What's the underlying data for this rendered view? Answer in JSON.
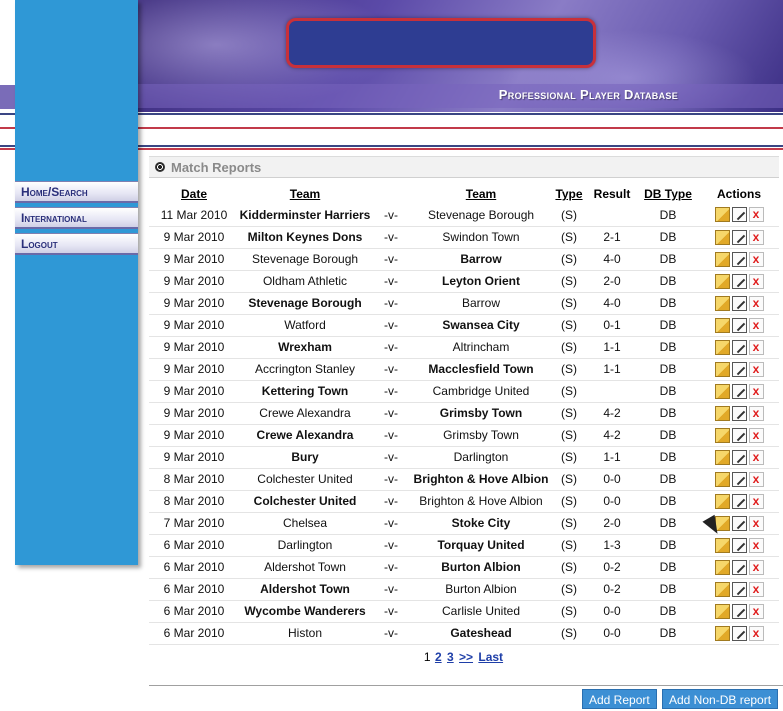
{
  "header": {
    "title": "Professional Player Database"
  },
  "nav": [
    {
      "label": "Home/Search"
    },
    {
      "label": "International"
    },
    {
      "label": "Logout"
    }
  ],
  "section": {
    "title": "Match Reports"
  },
  "table": {
    "headers": {
      "date": "Date",
      "team1": "Team",
      "team2": "Team",
      "type": "Type",
      "result": "Result",
      "dbtype": "DB Type",
      "actions": "Actions"
    },
    "rows": [
      {
        "date": "11 Mar 2010",
        "team1": "Kidderminster Harriers",
        "vs": "-v-",
        "team2": "Stevenage Borough",
        "type": "(S)",
        "result": "",
        "dbtype": "DB",
        "bold": "team1"
      },
      {
        "date": "9 Mar 2010",
        "team1": "Milton Keynes Dons",
        "vs": "-v-",
        "team2": "Swindon Town",
        "type": "(S)",
        "result": "2-1",
        "dbtype": "DB",
        "bold": "team1"
      },
      {
        "date": "9 Mar 2010",
        "team1": "Stevenage Borough",
        "vs": "-v-",
        "team2": "Barrow",
        "type": "(S)",
        "result": "4-0",
        "dbtype": "DB",
        "bold": "team2"
      },
      {
        "date": "9 Mar 2010",
        "team1": "Oldham Athletic",
        "vs": "-v-",
        "team2": "Leyton Orient",
        "type": "(S)",
        "result": "2-0",
        "dbtype": "DB",
        "bold": "team2"
      },
      {
        "date": "9 Mar 2010",
        "team1": "Stevenage Borough",
        "vs": "-v-",
        "team2": "Barrow",
        "type": "(S)",
        "result": "4-0",
        "dbtype": "DB",
        "bold": "team1"
      },
      {
        "date": "9 Mar 2010",
        "team1": "Watford",
        "vs": "-v-",
        "team2": "Swansea City",
        "type": "(S)",
        "result": "0-1",
        "dbtype": "DB",
        "bold": "team2"
      },
      {
        "date": "9 Mar 2010",
        "team1": "Wrexham",
        "vs": "-v-",
        "team2": "Altrincham",
        "type": "(S)",
        "result": "1-1",
        "dbtype": "DB",
        "bold": "team1"
      },
      {
        "date": "9 Mar 2010",
        "team1": "Accrington Stanley",
        "vs": "-v-",
        "team2": "Macclesfield Town",
        "type": "(S)",
        "result": "1-1",
        "dbtype": "DB",
        "bold": "team2"
      },
      {
        "date": "9 Mar 2010",
        "team1": "Kettering Town",
        "vs": "-v-",
        "team2": "Cambridge United",
        "type": "(S)",
        "result": "",
        "dbtype": "DB",
        "bold": "team1"
      },
      {
        "date": "9 Mar 2010",
        "team1": "Crewe Alexandra",
        "vs": "-v-",
        "team2": "Grimsby Town",
        "type": "(S)",
        "result": "4-2",
        "dbtype": "DB",
        "bold": "team2"
      },
      {
        "date": "9 Mar 2010",
        "team1": "Crewe Alexandra",
        "vs": "-v-",
        "team2": "Grimsby Town",
        "type": "(S)",
        "result": "4-2",
        "dbtype": "DB",
        "bold": "team1"
      },
      {
        "date": "9 Mar 2010",
        "team1": "Bury",
        "vs": "-v-",
        "team2": "Darlington",
        "type": "(S)",
        "result": "1-1",
        "dbtype": "DB",
        "bold": "team1"
      },
      {
        "date": "8 Mar 2010",
        "team1": "Colchester United",
        "vs": "-v-",
        "team2": "Brighton & Hove Albion",
        "type": "(S)",
        "result": "0-0",
        "dbtype": "DB",
        "bold": "team2"
      },
      {
        "date": "8 Mar 2010",
        "team1": "Colchester United",
        "vs": "-v-",
        "team2": "Brighton & Hove Albion",
        "type": "(S)",
        "result": "0-0",
        "dbtype": "DB",
        "bold": "team1"
      },
      {
        "date": "7 Mar 2010",
        "team1": "Chelsea",
        "vs": "-v-",
        "team2": "Stoke City",
        "type": "(S)",
        "result": "2-0",
        "dbtype": "DB",
        "bold": "team2"
      },
      {
        "date": "6 Mar 2010",
        "team1": "Darlington",
        "vs": "-v-",
        "team2": "Torquay United",
        "type": "(S)",
        "result": "1-3",
        "dbtype": "DB",
        "bold": "team2"
      },
      {
        "date": "6 Mar 2010",
        "team1": "Aldershot Town",
        "vs": "-v-",
        "team2": "Burton Albion",
        "type": "(S)",
        "result": "0-2",
        "dbtype": "DB",
        "bold": "team2"
      },
      {
        "date": "6 Mar 2010",
        "team1": "Aldershot Town",
        "vs": "-v-",
        "team2": "Burton Albion",
        "type": "(S)",
        "result": "0-2",
        "dbtype": "DB",
        "bold": "team1"
      },
      {
        "date": "6 Mar 2010",
        "team1": "Wycombe Wanderers",
        "vs": "-v-",
        "team2": "Carlisle United",
        "type": "(S)",
        "result": "0-0",
        "dbtype": "DB",
        "bold": "team1"
      },
      {
        "date": "6 Mar 2010",
        "team1": "Histon",
        "vs": "-v-",
        "team2": "Gateshead",
        "type": "(S)",
        "result": "0-0",
        "dbtype": "DB",
        "bold": "team2"
      }
    ],
    "action_icons": [
      "open-folder-icon",
      "edit-icon",
      "delete-icon"
    ],
    "delete_glyph": "x"
  },
  "pager": {
    "current": "1",
    "pages": [
      "2",
      "3"
    ],
    "next": ">>",
    "last": "Last"
  },
  "buttons": {
    "add_report": "Add Report",
    "add_non_db": "Add Non-DB report"
  },
  "colors": {
    "sidebar": "#2f98d6",
    "button": "#3c8fd4",
    "nav_text": "#2a2f7a",
    "accent_red": "#c23a4a"
  }
}
